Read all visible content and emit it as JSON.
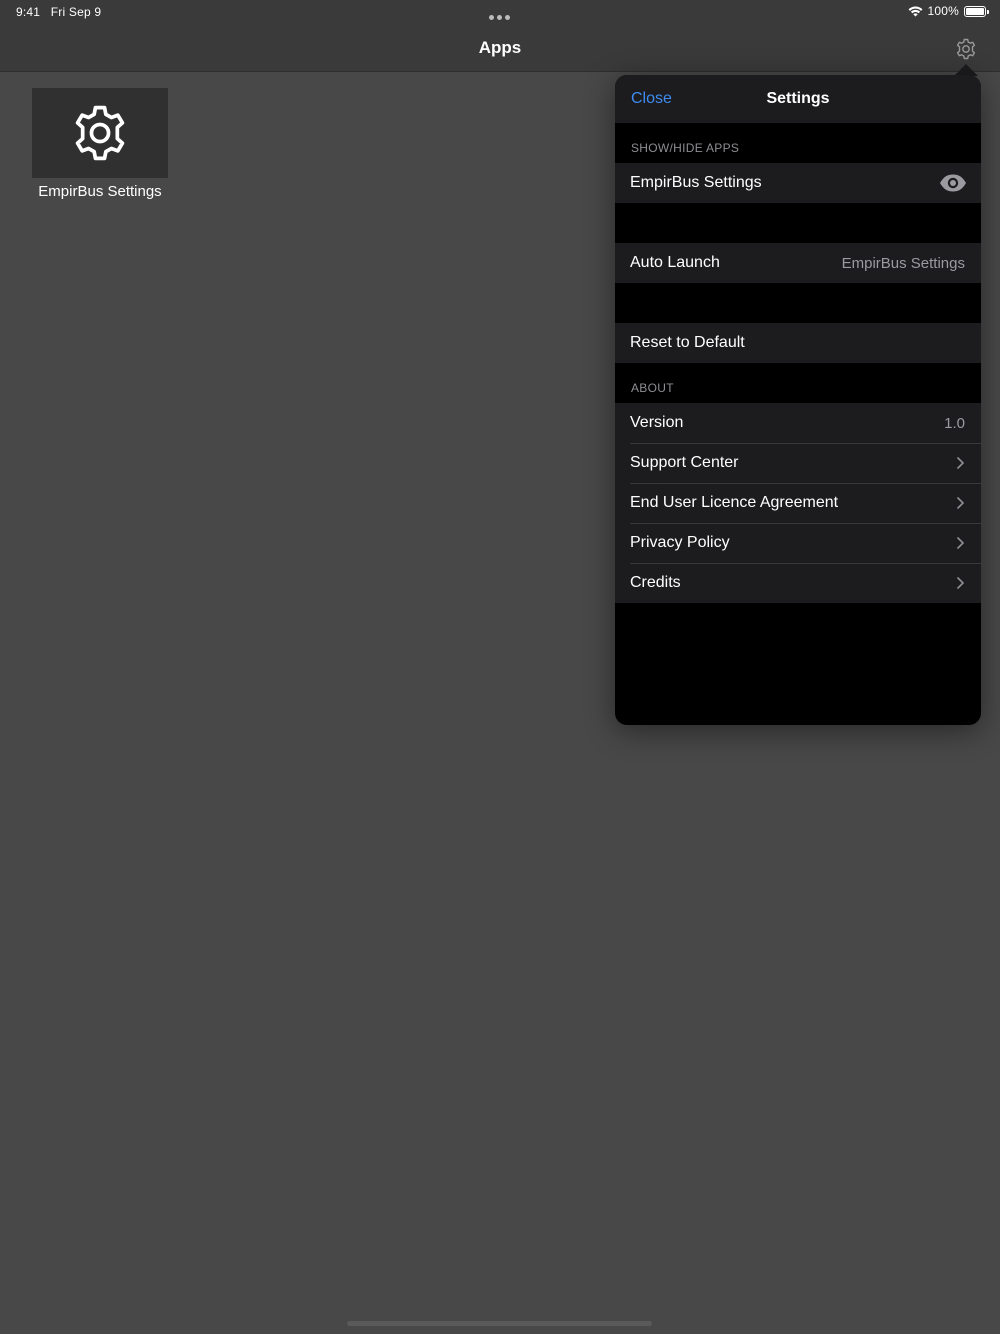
{
  "status_bar": {
    "time": "9:41",
    "date": "Fri Sep 9",
    "battery": "100%",
    "wifi_icon": "wifi-icon",
    "battery_icon": "battery-icon"
  },
  "navbar": {
    "title": "Apps",
    "settings_icon": "gear-icon"
  },
  "apps": [
    {
      "label": "EmpirBus Settings",
      "icon": "gear-icon"
    }
  ],
  "settings": {
    "title": "Settings",
    "close_label": "Close",
    "show_hide_header": "SHOW/HIDE APPS",
    "show_hide_items": [
      {
        "label": "EmpirBus Settings",
        "icon": "eye-icon"
      }
    ],
    "auto_launch": {
      "label": "Auto Launch",
      "value": "EmpirBus Settings"
    },
    "reset_label": "Reset to Default",
    "about_header": "ABOUT",
    "version": {
      "label": "Version",
      "value": "1.0"
    },
    "about_links": [
      {
        "label": "Support Center"
      },
      {
        "label": "End User Licence Agreement"
      },
      {
        "label": "Privacy Policy"
      },
      {
        "label": "Credits"
      }
    ]
  },
  "colors": {
    "accent": "#3d8bef",
    "background": "#484848",
    "bar": "#3a3a3a",
    "cell": "#1c1c1e"
  }
}
